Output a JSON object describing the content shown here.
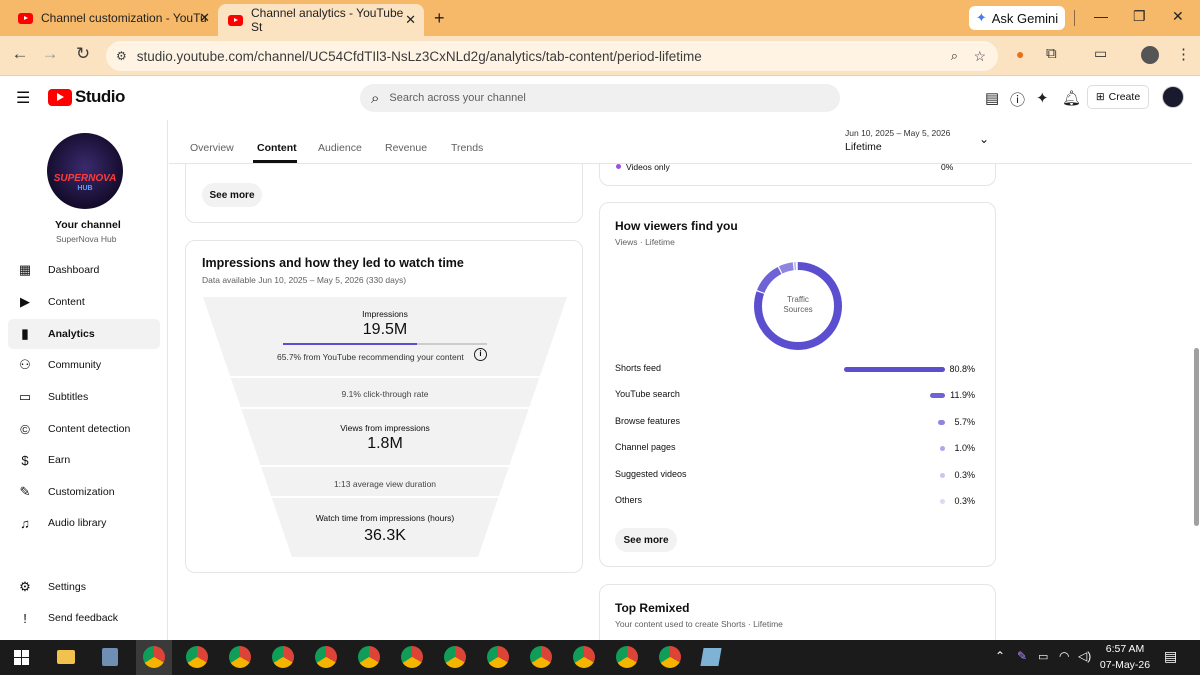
{
  "browser": {
    "tabs": [
      {
        "title": "Channel customization - YouTu"
      },
      {
        "title": "Channel analytics - YouTube St"
      }
    ],
    "url": "studio.youtube.com/channel/UC54CfdTIl3-NsLz3CxNLd2g/analytics/tab-content/period-lifetime",
    "ask_gemini": "Ask Gemini"
  },
  "header": {
    "logo": "Studio",
    "search_placeholder": "Search across your channel",
    "create_label": "Create"
  },
  "sidebar": {
    "channel_label": "Your channel",
    "channel_name": "SuperNova Hub",
    "avatar_text_1": "SUPERNOVA",
    "avatar_text_2": "HUB",
    "items": [
      {
        "label": "Dashboard",
        "icon": "dashboard-icon"
      },
      {
        "label": "Content",
        "icon": "content-icon"
      },
      {
        "label": "Analytics",
        "icon": "analytics-icon"
      },
      {
        "label": "Community",
        "icon": "community-icon"
      },
      {
        "label": "Subtitles",
        "icon": "subtitles-icon"
      },
      {
        "label": "Content detection",
        "icon": "copyright-icon"
      },
      {
        "label": "Earn",
        "icon": "dollar-icon"
      },
      {
        "label": "Customization",
        "icon": "magic-wand-icon"
      },
      {
        "label": "Audio library",
        "icon": "audio-library-icon"
      },
      {
        "label": "Settings",
        "icon": "gear-icon"
      },
      {
        "label": "Send feedback",
        "icon": "feedback-icon"
      }
    ]
  },
  "analytics": {
    "tabs": [
      "Overview",
      "Content",
      "Audience",
      "Revenue",
      "Trends"
    ],
    "active_tab": "Content",
    "period_range": "Jun 10, 2025 – May 5, 2026",
    "period_label": "Lifetime"
  },
  "left_top_card": {
    "see_more": "See more"
  },
  "impressions": {
    "title": "Impressions and how they led to watch time",
    "subtitle": "Data available Jun 10, 2025 – May 5, 2026 (330 days)",
    "impressions_label": "Impressions",
    "impressions_value": "19.5M",
    "recommend_note": "65.7% from YouTube recommending your content",
    "recommend_fraction": 0.657,
    "ctr_note": "9.1% click-through rate",
    "views_label": "Views from impressions",
    "views_value": "1.8M",
    "avd_note": "1:13 average view duration",
    "watch_label": "Watch time from impressions (hours)",
    "watch_value": "36.3K"
  },
  "right_top_card": {
    "videos_only_label": "Videos only",
    "videos_only_value": "0%"
  },
  "viewers": {
    "title": "How viewers find you",
    "subtitle": "Views · Lifetime",
    "donut_label_1": "Traffic",
    "donut_label_2": "Sources",
    "sources": [
      {
        "name": "Shorts feed",
        "value": "80.8%",
        "pct": 80.8,
        "color": "#5c4fcf"
      },
      {
        "name": "YouTube search",
        "value": "11.9%",
        "pct": 11.9,
        "color": "#6e62d6"
      },
      {
        "name": "Browse features",
        "value": "5.7%",
        "pct": 5.7,
        "color": "#8e85e0"
      },
      {
        "name": "Channel pages",
        "value": "1.0%",
        "pct": 1.0,
        "color": "#aea7ea"
      },
      {
        "name": "Suggested videos",
        "value": "0.3%",
        "pct": 0.3,
        "color": "#c9c4f1"
      },
      {
        "name": "Others",
        "value": "0.3%",
        "pct": 0.3,
        "color": "#dcd9f6"
      }
    ],
    "see_more": "See more"
  },
  "top_remixed": {
    "title": "Top Remixed",
    "subtitle": "Your content used to create Shorts · Lifetime"
  },
  "taskbar": {
    "time": "6:57 AM",
    "date": "07-May-26"
  }
}
